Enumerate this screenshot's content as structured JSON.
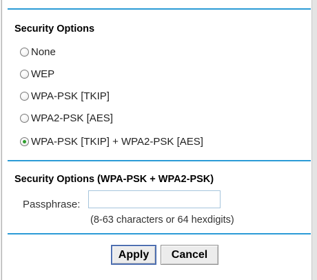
{
  "security_options": {
    "title": "Security Options",
    "options": [
      {
        "label": "None",
        "checked": false
      },
      {
        "label": "WEP",
        "checked": false
      },
      {
        "label": "WPA-PSK [TKIP]",
        "checked": false
      },
      {
        "label": "WPA2-PSK [AES]",
        "checked": false
      },
      {
        "label": "WPA-PSK [TKIP] + WPA2-PSK [AES]",
        "checked": true
      }
    ]
  },
  "wpa_section": {
    "title": "Security Options (WPA-PSK + WPA2-PSK)",
    "passphrase_label": "Passphrase:",
    "passphrase_value": "",
    "hint": "(8-63 characters or 64 hexdigits)"
  },
  "actions": {
    "apply_label": "Apply",
    "cancel_label": "Cancel"
  },
  "colors": {
    "rule": "#2a9bd6",
    "radio_selected": "#2e9e2e"
  }
}
